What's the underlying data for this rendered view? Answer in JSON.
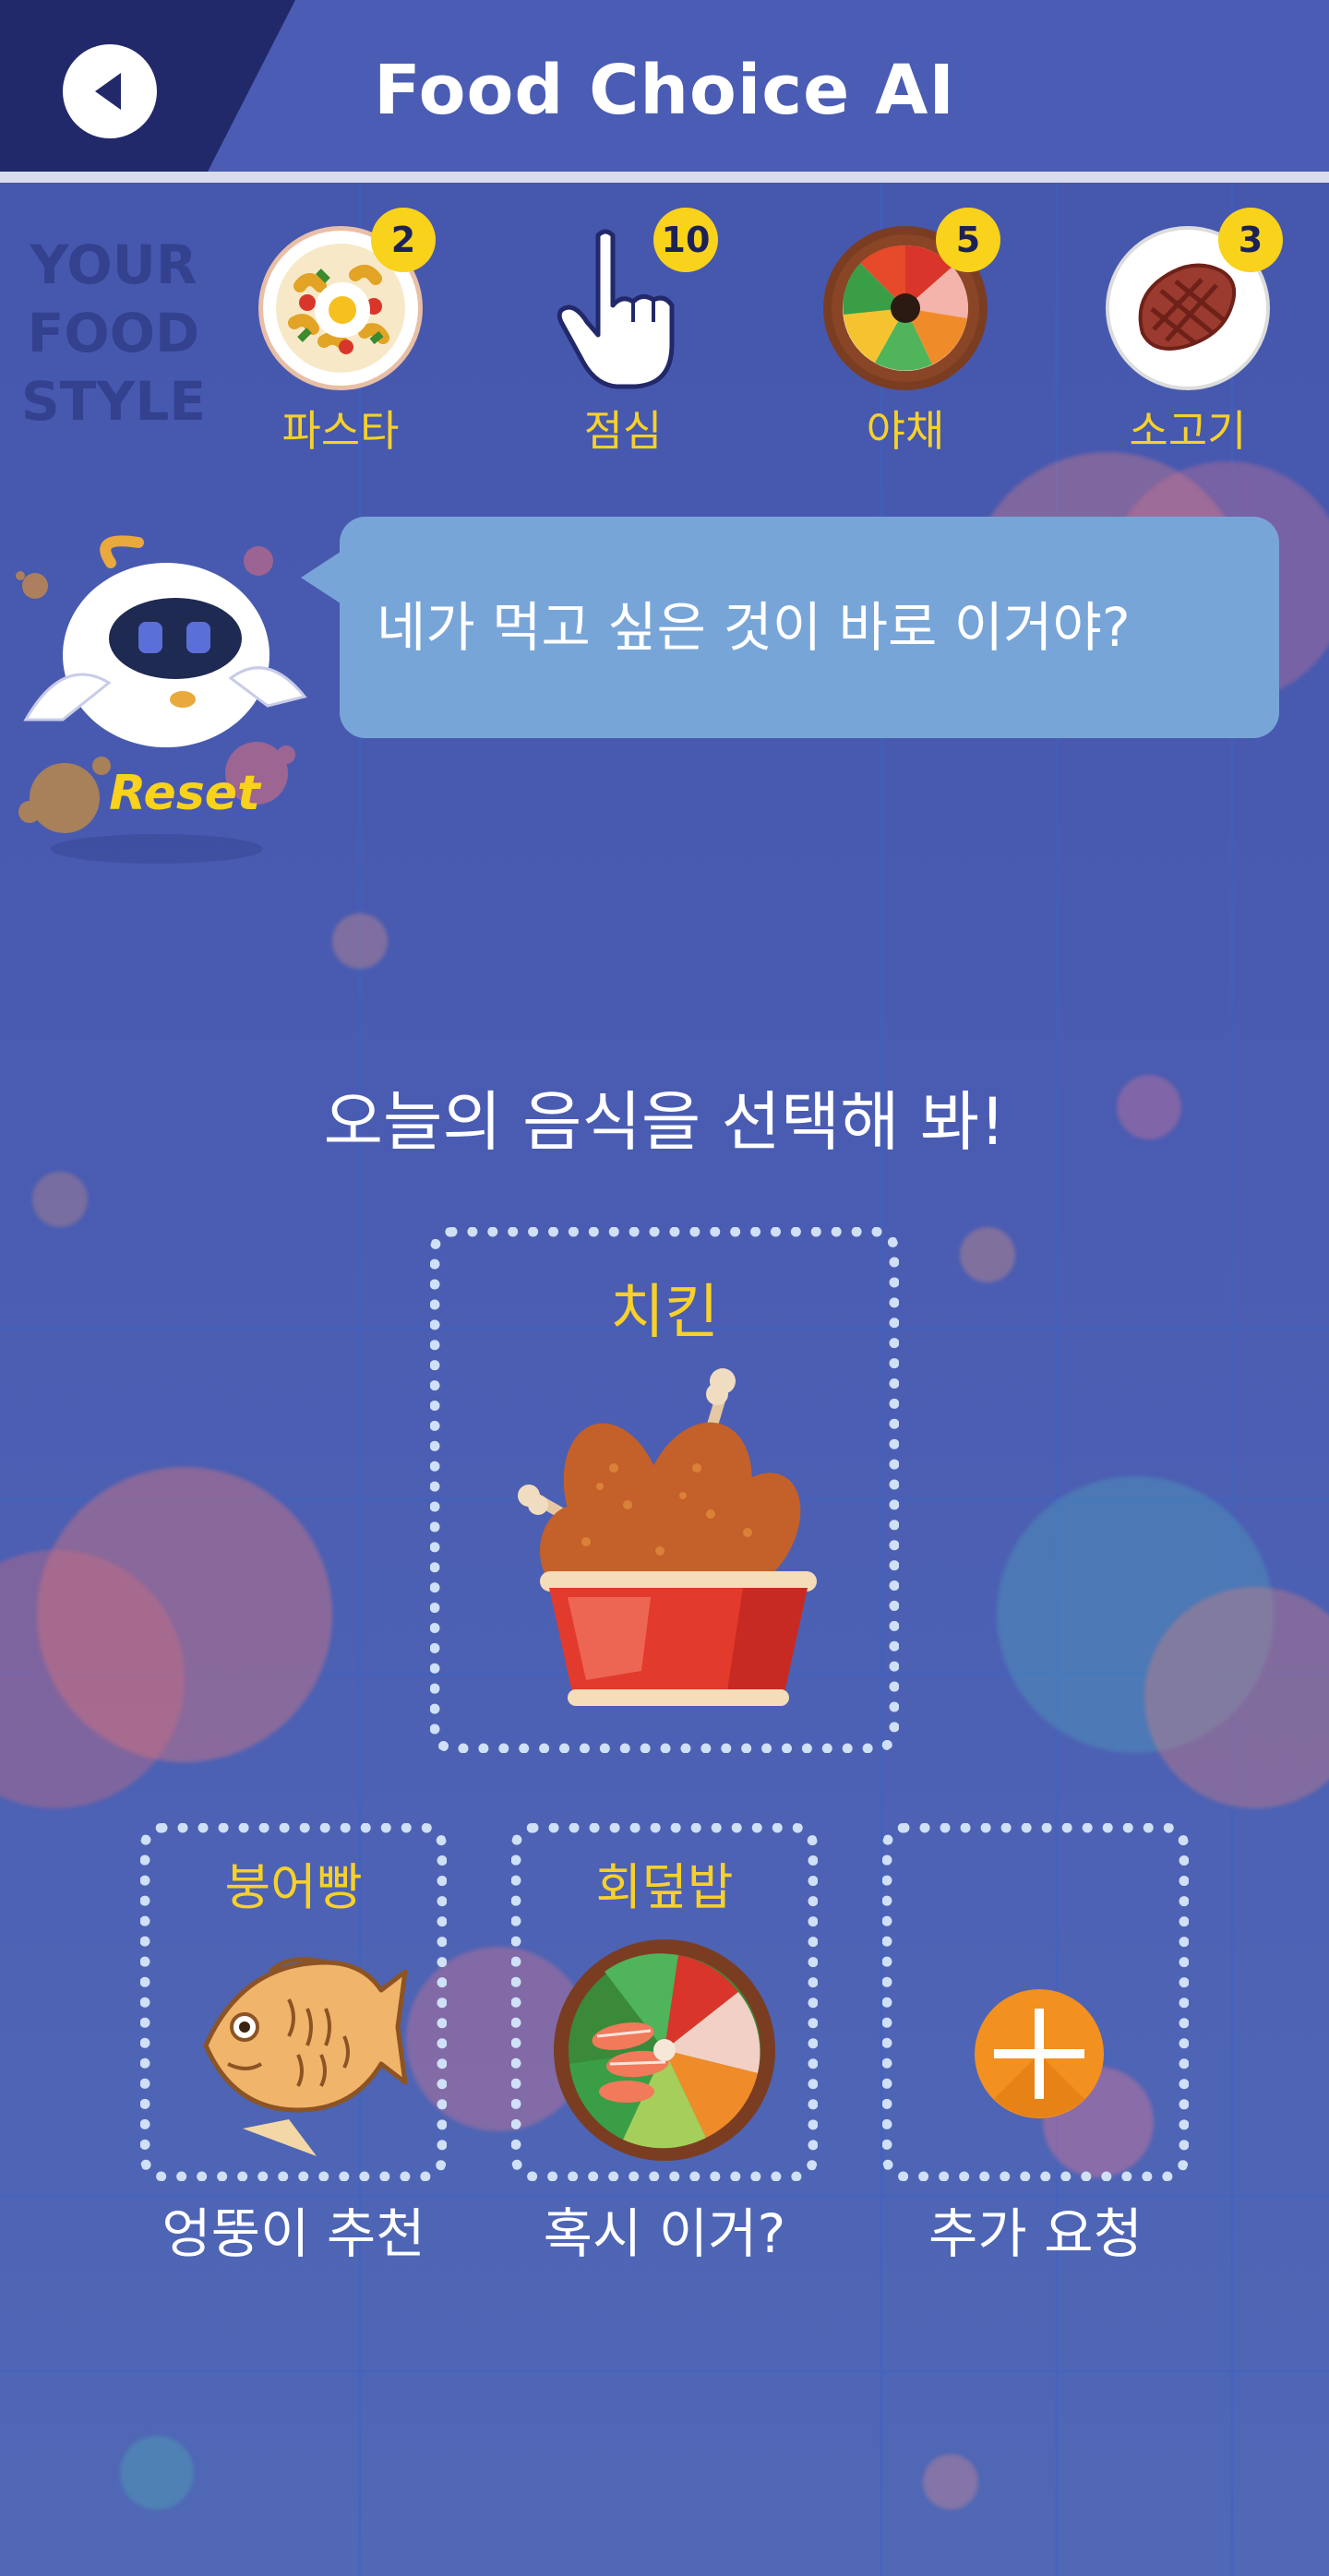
{
  "header": {
    "title": "Food Choice AI",
    "back_icon": "chevron-left-icon"
  },
  "food_style": {
    "label_lines": [
      "YOUR",
      "FOOD",
      "STYLE"
    ],
    "items": [
      {
        "label": "파스타",
        "count": "2",
        "icon": "pasta-icon"
      },
      {
        "label": "점심",
        "count": "10",
        "icon": "pointing-hand-icon"
      },
      {
        "label": "야채",
        "count": "5",
        "icon": "vegetable-bowl-icon"
      },
      {
        "label": "소고기",
        "count": "3",
        "icon": "steak-icon"
      }
    ]
  },
  "assistant": {
    "message": "네가 먹고 싶은 것이 바로 이거야?",
    "reset_label": "Reset"
  },
  "main": {
    "prompt": "오늘의 음식을 선택해 봐!",
    "featured": {
      "label": "치킨",
      "icon": "fried-chicken-bucket-icon"
    },
    "options": [
      {
        "title": "붕어빵",
        "caption": "엉뚱이 추천",
        "icon": "fish-bread-icon"
      },
      {
        "title": "회덮밥",
        "caption": "혹시 이거?",
        "icon": "sashimi-bowl-icon"
      },
      {
        "title": "",
        "caption": "추가 요청",
        "icon": "plus-circle-icon"
      }
    ]
  },
  "colors": {
    "background": "#4a5cb2",
    "header_dark": "#22296a",
    "accent_yellow": "#f7d12a",
    "bubble": "#78a5d8",
    "add_orange": "#f29020"
  }
}
